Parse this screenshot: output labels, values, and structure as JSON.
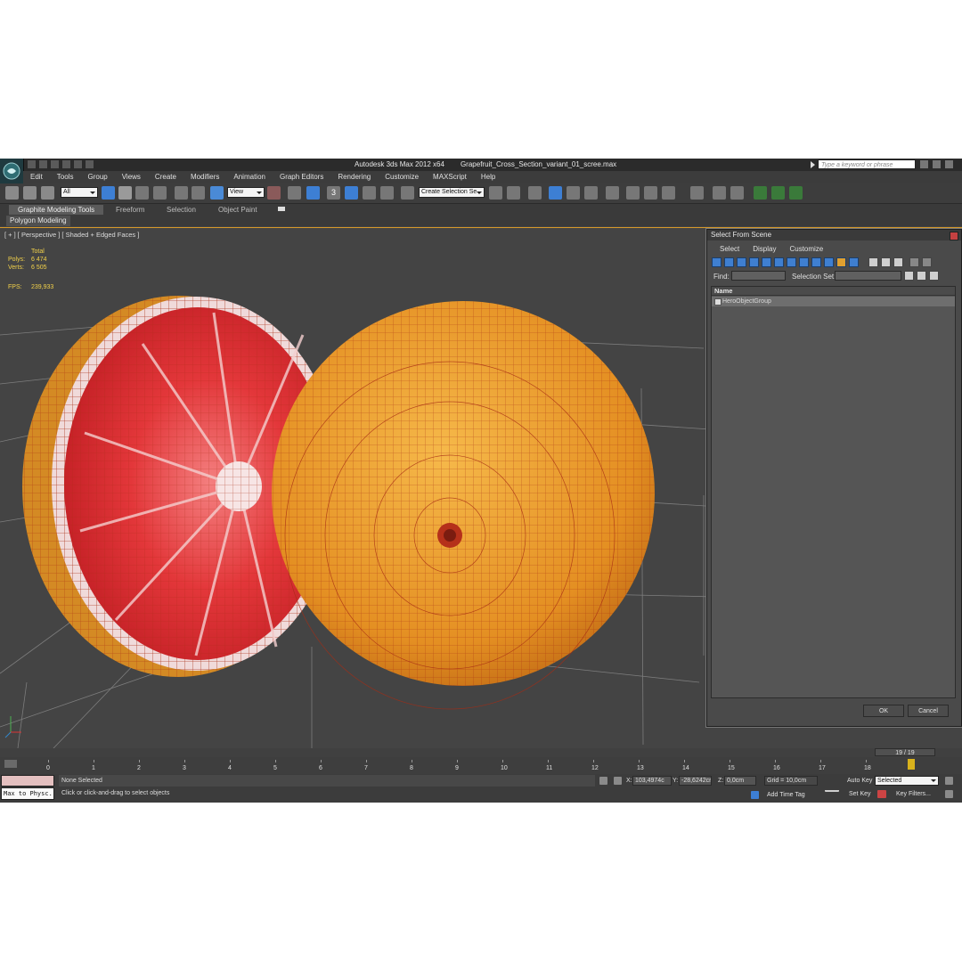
{
  "window": {
    "app_title": "Autodesk 3ds Max  2012 x64",
    "file_name": "Grapefruit_Cross_Section_variant_01_scree.max",
    "search_placeholder": "Type a keyword or phrase"
  },
  "menu": [
    "Edit",
    "Tools",
    "Group",
    "Views",
    "Create",
    "Modifiers",
    "Animation",
    "Graph Editors",
    "Rendering",
    "Customize",
    "MAXScript",
    "Help"
  ],
  "toolbar": {
    "selection_filter": "All",
    "reference_coord": "View",
    "named_selection": "Create Selection Se",
    "snap_label": "3"
  },
  "ribbon": {
    "tabs": [
      "Graphite Modeling Tools",
      "Freeform",
      "Selection",
      "Object Paint"
    ],
    "active_panel": "Polygon Modeling"
  },
  "viewport": {
    "label": "[ + ] [ Perspective ] [ Shaded + Edged Faces ]",
    "stats_header": "Total",
    "polys_label": "Polys:",
    "polys_value": "6 474",
    "verts_label": "Verts:",
    "verts_value": "6 505",
    "fps_label": "FPS:",
    "fps_value": "239,933",
    "colors": {
      "flesh": "#e0333a",
      "peel": "#f0a12a",
      "wire": "#b5301a",
      "grid": "#8a8a8a"
    }
  },
  "dialog": {
    "title": "Select From Scene",
    "menu": [
      "Select",
      "Display",
      "Customize"
    ],
    "find_label": "Find:",
    "selection_set_label": "Selection Set:",
    "column_header": "Name",
    "items": [
      "HeroObjectGroup"
    ],
    "ok_label": "OK",
    "cancel_label": "Cancel"
  },
  "timeline": {
    "frame_display": "19 / 19",
    "ticks": [
      "0",
      "1",
      "2",
      "3",
      "4",
      "5",
      "6",
      "7",
      "8",
      "9",
      "10",
      "11",
      "12",
      "13",
      "14",
      "15",
      "16",
      "17",
      "18"
    ]
  },
  "status": {
    "maxscript": "Max to Physc.",
    "selection": "None Selected",
    "prompt": "Click or click-and-drag to select objects",
    "x_label": "X:",
    "x_value": "103,4974c",
    "y_label": "Y:",
    "y_value": "-28,6242cr",
    "z_label": "Z:",
    "z_value": "0,0cm",
    "grid": "Grid = 10,0cm",
    "add_time_tag": "Add Time Tag",
    "auto_key": "Auto Key",
    "auto_key_mode": "Selected",
    "set_key": "Set Key",
    "key_filters": "Key Filters..."
  }
}
